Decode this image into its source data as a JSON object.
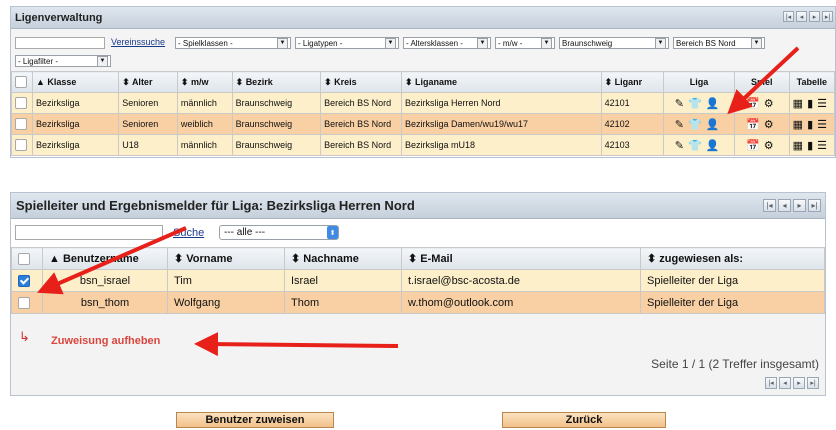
{
  "liga_panel": {
    "title": "Ligenverwaltung",
    "vereinssuche_label": "Vereinssuche",
    "filters": [
      "- Spielklassen -",
      "- Ligatypen -",
      "- Altersklassen -",
      "- m/w -",
      "Braunschweig",
      "Bereich BS Nord"
    ],
    "ligafilter": "- Ligafilter -",
    "columns": [
      "Klasse",
      "Alter",
      "m/w",
      "Bezirk",
      "Kreis",
      "Liganame",
      "Liganr",
      "Liga",
      "Spiel",
      "Tabelle"
    ],
    "rows": [
      {
        "klasse": "Bezirksliga",
        "alter": "Senioren",
        "mw": "männlich",
        "bezirk": "Braunschweig",
        "kreis": "Bereich BS Nord",
        "liganame": "Bezirksliga Herren Nord",
        "liganr": "42101"
      },
      {
        "klasse": "Bezirksliga",
        "alter": "Senioren",
        "mw": "weiblich",
        "bezirk": "Braunschweig",
        "kreis": "Bereich BS Nord",
        "liganame": "Bezirksliga Damen/wu19/wu17",
        "liganr": "42102"
      },
      {
        "klasse": "Bezirksliga",
        "alter": "U18",
        "mw": "männlich",
        "bezirk": "Braunschweig",
        "kreis": "Bereich BS Nord",
        "liganame": "Bezirksliga mU18",
        "liganr": "42103"
      }
    ]
  },
  "spielleiter_panel": {
    "title": "Spielleiter und Ergebnismelder für Liga: Bezirksliga Herren Nord",
    "suche_label": "Suche",
    "filter_value": "--- alle ---",
    "columns": [
      "Benutzername",
      "Vorname",
      "Nachname",
      "E-Mail",
      "zugewiesen als:"
    ],
    "rows": [
      {
        "benutzername": "bsn_israel",
        "vorname": "Tim",
        "nachname": "Israel",
        "email": "t.israel@bsc-acosta.de",
        "zugewiesen": "Spielleiter der Liga",
        "checked": true
      },
      {
        "benutzername": "bsn_thom",
        "vorname": "Wolfgang",
        "nachname": "Thom",
        "email": "w.thom@outlook.com",
        "zugewiesen": "Spielleiter der Liga",
        "checked": false
      }
    ],
    "action_label": "Zuweisung aufheben",
    "pagination_text": "Seite 1 / 1 (2 Treffer insgesamt)"
  },
  "buttons": {
    "assign": "Benutzer zuweisen",
    "back": "Zurück"
  },
  "colors": {
    "row_yellow": "#fcefc9",
    "row_orange": "#f8d0a4",
    "highlight_red": "#e8201a",
    "link_blue": "#1a3a8c"
  }
}
